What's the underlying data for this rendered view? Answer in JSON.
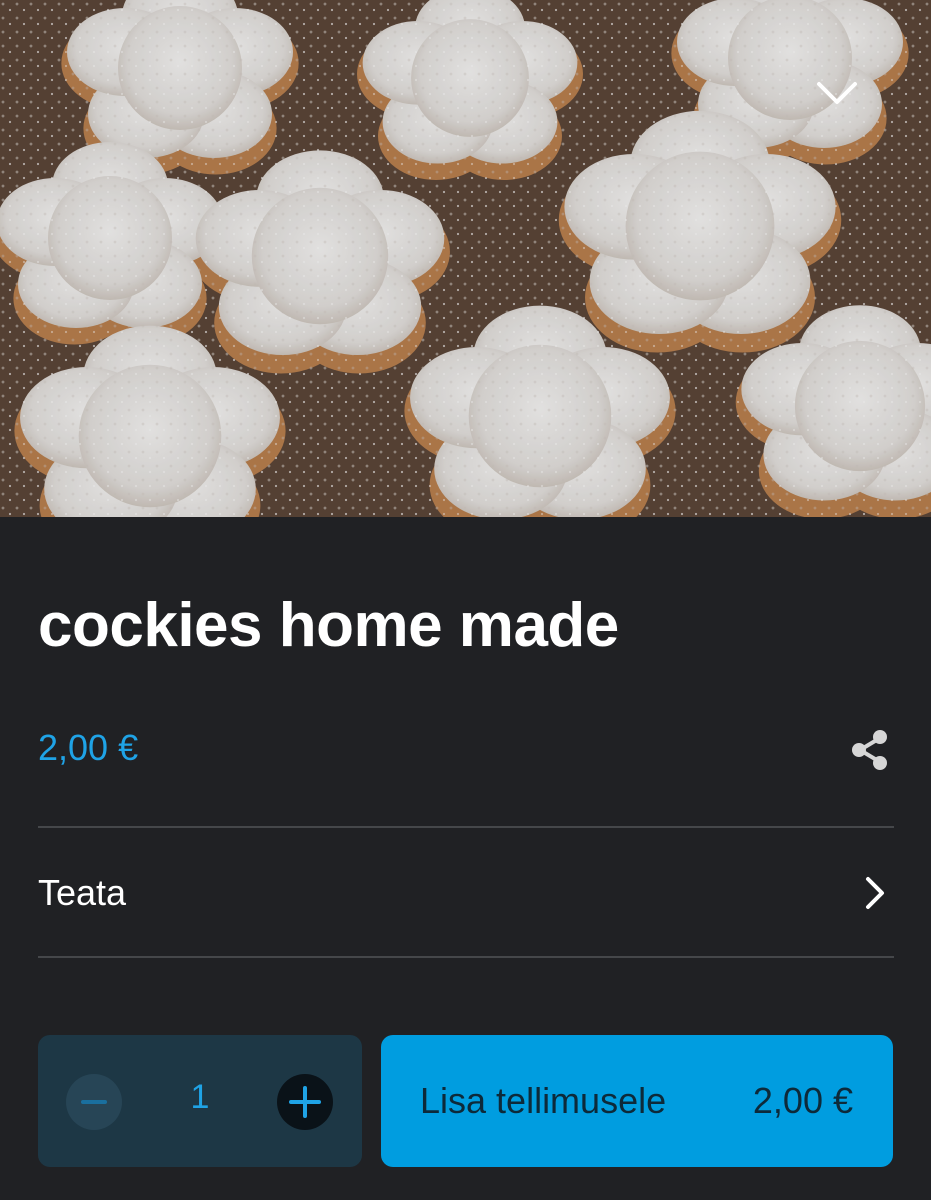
{
  "product": {
    "image": {
      "alt": "",
      "overlay_icon": "chevron-down-icon"
    },
    "title": "cockies home made",
    "price": "2,00 €",
    "share_icon": "share-icon"
  },
  "report": {
    "label": "Teata",
    "icon": "chevron-right-icon"
  },
  "order": {
    "quantity": "1",
    "decrement_icon": "minus-icon",
    "increment_icon": "plus-icon",
    "add_button_label": "Lisa tellimusele",
    "add_button_total": "2,00 €"
  },
  "colors": {
    "background": "#202124",
    "accent": "#009de0",
    "price_text": "#1fa3e6",
    "stepper_bg": "#1d3745",
    "divider": "#45474a"
  }
}
